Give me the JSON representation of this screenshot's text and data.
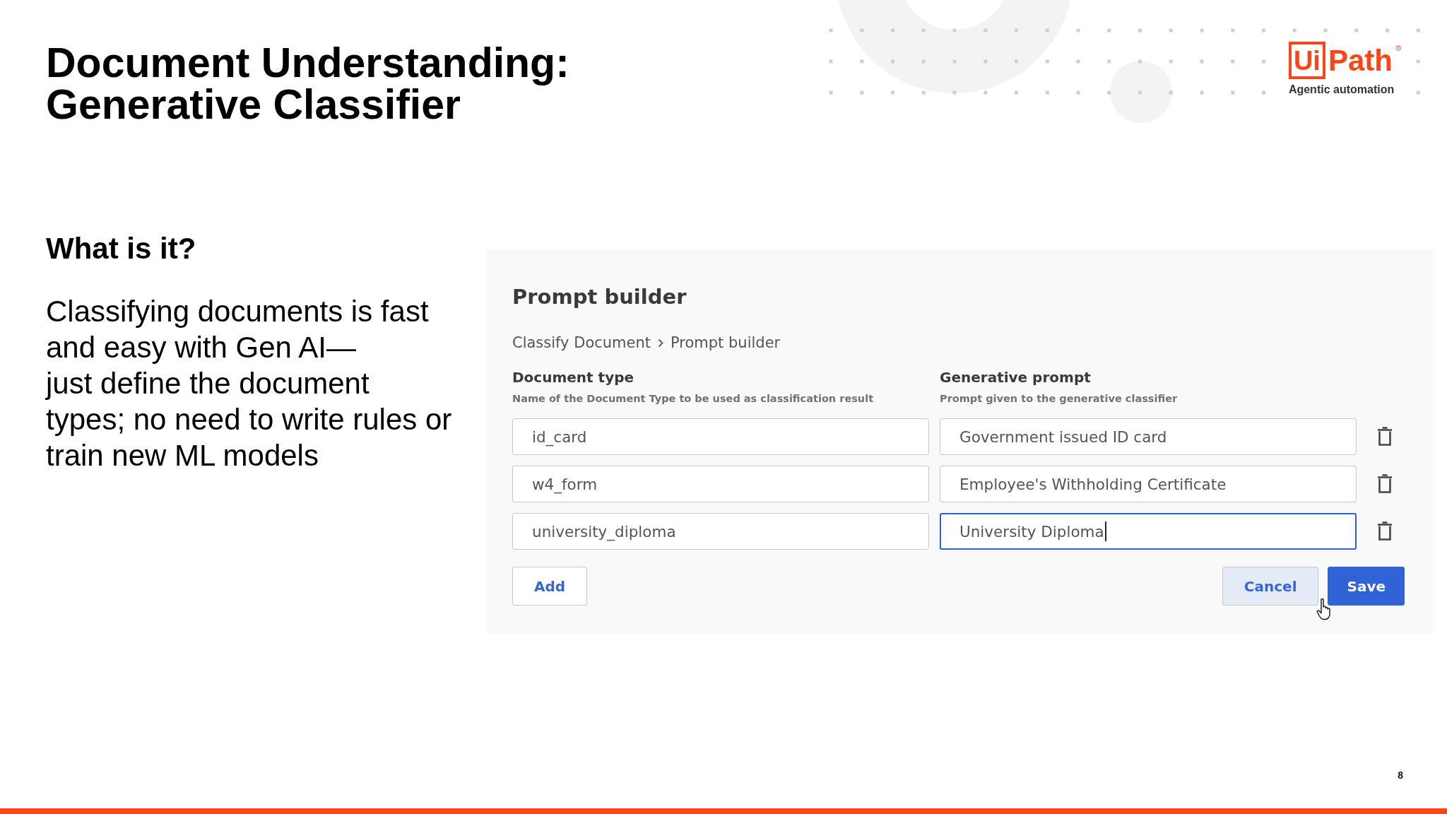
{
  "slide": {
    "title": "Document Understanding: Generative Classifier",
    "page_number": "8"
  },
  "logo": {
    "mark": "Ui",
    "wordmark": "Path",
    "registered": "®",
    "tagline": "Agentic automation"
  },
  "intro": {
    "heading": "What is it?",
    "body": "Classifying documents is fast\nand easy with Gen AI—\njust define the document\ntypes; no need to write rules or\ntrain new ML models"
  },
  "prompt_builder": {
    "title": "Prompt builder",
    "breadcrumb": [
      "Classify Document",
      "Prompt builder"
    ],
    "columns": [
      {
        "label": "Document type",
        "hint": "Name of the Document Type to be used as classification result"
      },
      {
        "label": "Generative prompt",
        "hint": "Prompt given to the generative classifier"
      }
    ],
    "rows": [
      {
        "document_type": {
          "value": "id_card",
          "focused": false
        },
        "prompt": {
          "value": "Government issued ID card",
          "focused": false
        }
      },
      {
        "document_type": {
          "value": "w4_form",
          "focused": false
        },
        "prompt": {
          "value": "Employee's Withholding Certificate",
          "focused": false
        }
      },
      {
        "document_type": {
          "value": "university_diploma",
          "focused": false
        },
        "prompt": {
          "value": "University Diploma",
          "focused": true
        }
      }
    ],
    "add_button": {
      "label": "Add",
      "hovered": false
    },
    "actions": [
      {
        "label": "Cancel",
        "kind": "secondary",
        "hovered": true
      },
      {
        "label": "Save",
        "kind": "primary",
        "hovered": false
      }
    ]
  }
}
